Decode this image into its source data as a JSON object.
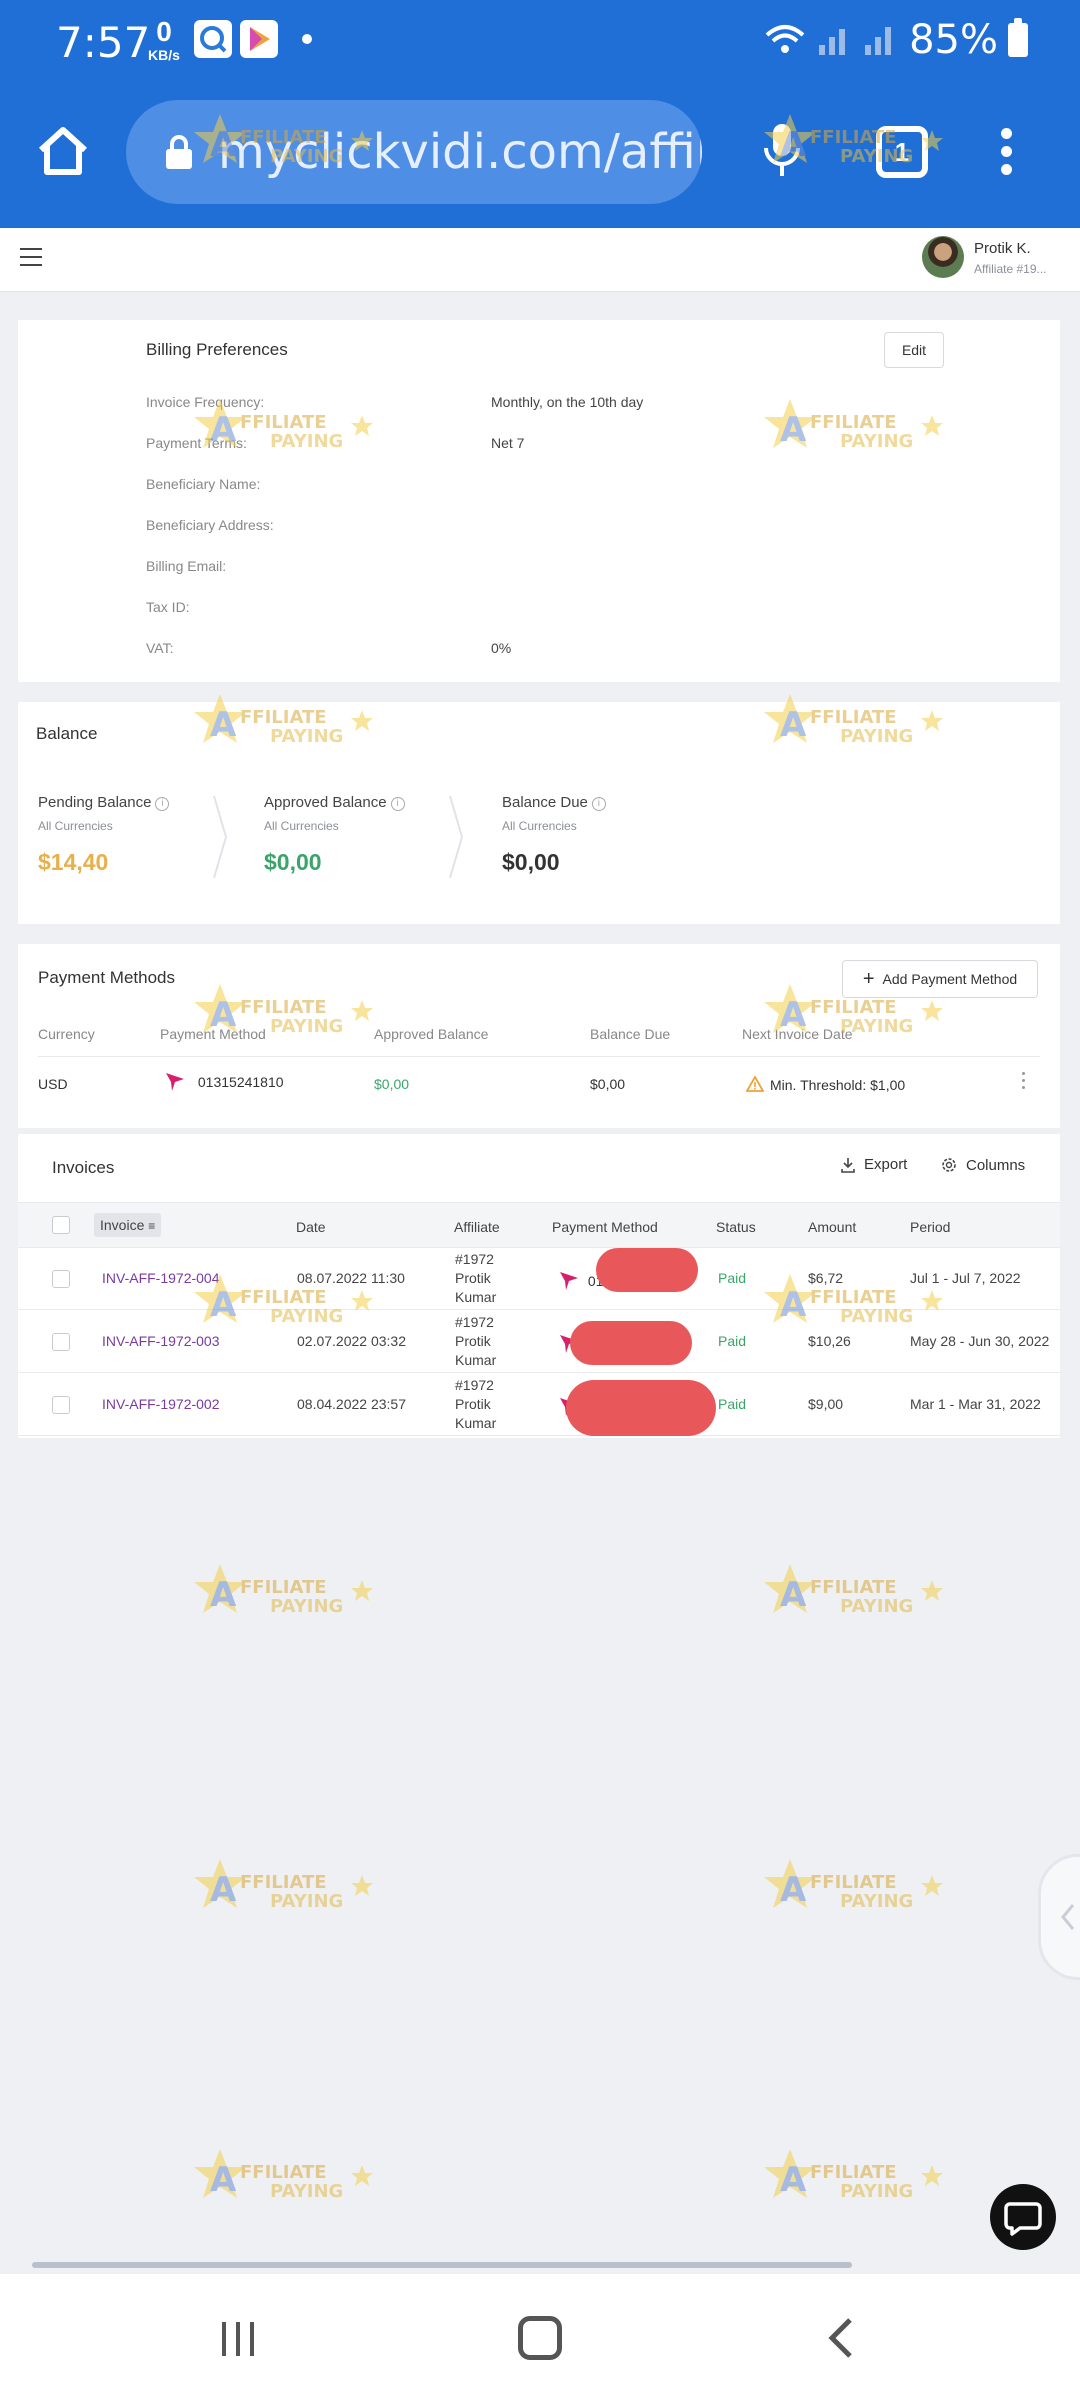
{
  "status_bar": {
    "time": "7:57",
    "net_speed_value": "0",
    "net_speed_unit": "KB/s",
    "battery_percent": "85%",
    "icons": [
      "wifi-icon",
      "signal-icon",
      "battery-icon"
    ]
  },
  "browser": {
    "url": "myclickvidi.com/affilia",
    "tab_count": "1",
    "icons": [
      "home-icon",
      "lock-icon",
      "mic-icon",
      "tabs-icon",
      "more-menu-icon"
    ]
  },
  "header": {
    "user_name": "Protik K.",
    "user_subtitle": "Affiliate #19..."
  },
  "billing": {
    "title": "Billing Preferences",
    "edit_label": "Edit",
    "rows": [
      {
        "label": "Invoice Frequency:",
        "value": "Monthly, on the 10th day"
      },
      {
        "label": "Payment Terms:",
        "value": "Net 7"
      },
      {
        "label": "Beneficiary Name:",
        "value": ""
      },
      {
        "label": "Beneficiary Address:",
        "value": ""
      },
      {
        "label": "Billing Email:",
        "value": ""
      },
      {
        "label": "Tax ID:",
        "value": ""
      },
      {
        "label": "VAT:",
        "value": "0%"
      }
    ]
  },
  "balance": {
    "title": "Balance",
    "items": [
      {
        "label": "Pending Balance",
        "sub": "All Currencies",
        "amount": "$14,40",
        "color": "#e8b04a"
      },
      {
        "label": "Approved Balance",
        "sub": "All Currencies",
        "amount": "$0,00",
        "color": "#3aa56b"
      },
      {
        "label": "Balance Due",
        "sub": "All Currencies",
        "amount": "$0,00",
        "color": "#333333"
      }
    ]
  },
  "payment_methods": {
    "title": "Payment Methods",
    "add_label": "Add Payment Method",
    "headers": [
      "Currency",
      "Payment Method",
      "Approved Balance",
      "Balance Due",
      "Next Invoice Date"
    ],
    "row": {
      "currency": "USD",
      "method": "01315241810",
      "approved_balance": "$0,00",
      "balance_due": "$0,00",
      "next_invoice": "Min. Threshold: $1,00"
    }
  },
  "invoices": {
    "title": "Invoices",
    "export_label": "Export",
    "columns_label": "Columns",
    "headers": [
      "Invoice",
      "Date",
      "Affiliate",
      "Payment Method",
      "Status",
      "Amount",
      "Period"
    ],
    "rows": [
      {
        "invoice": "INV-AFF-1972-004",
        "date": "08.07.2022 11:30",
        "aff_id": "#1972",
        "aff_first": "Protik",
        "aff_last": "Kumar",
        "method": "01",
        "status": "Paid",
        "amount": "$6,72",
        "period": "Jul 1 - Jul 7, 2022"
      },
      {
        "invoice": "INV-AFF-1972-003",
        "date": "02.07.2022 03:32",
        "aff_id": "#1972",
        "aff_first": "Protik",
        "aff_last": "Kumar",
        "method": "",
        "status": "Paid",
        "amount": "$10,26",
        "period": "May 28 - Jun 30, 2022"
      },
      {
        "invoice": "INV-AFF-1972-002",
        "date": "08.04.2022 23:57",
        "aff_id": "#1972",
        "aff_first": "Protik",
        "aff_last": "Kumar",
        "method": "",
        "status": "Paid",
        "amount": "$9,00",
        "period": "Mar 1 - Mar 31, 2022"
      }
    ]
  },
  "watermark": {
    "line1": "AFFILIATE",
    "line2": "PAYING"
  },
  "colors": {
    "chrome_blue": "#1f6fd6",
    "link_purple": "#7a3a9e",
    "paid_green": "#3aa56b",
    "pending_orange": "#e8b04a"
  }
}
